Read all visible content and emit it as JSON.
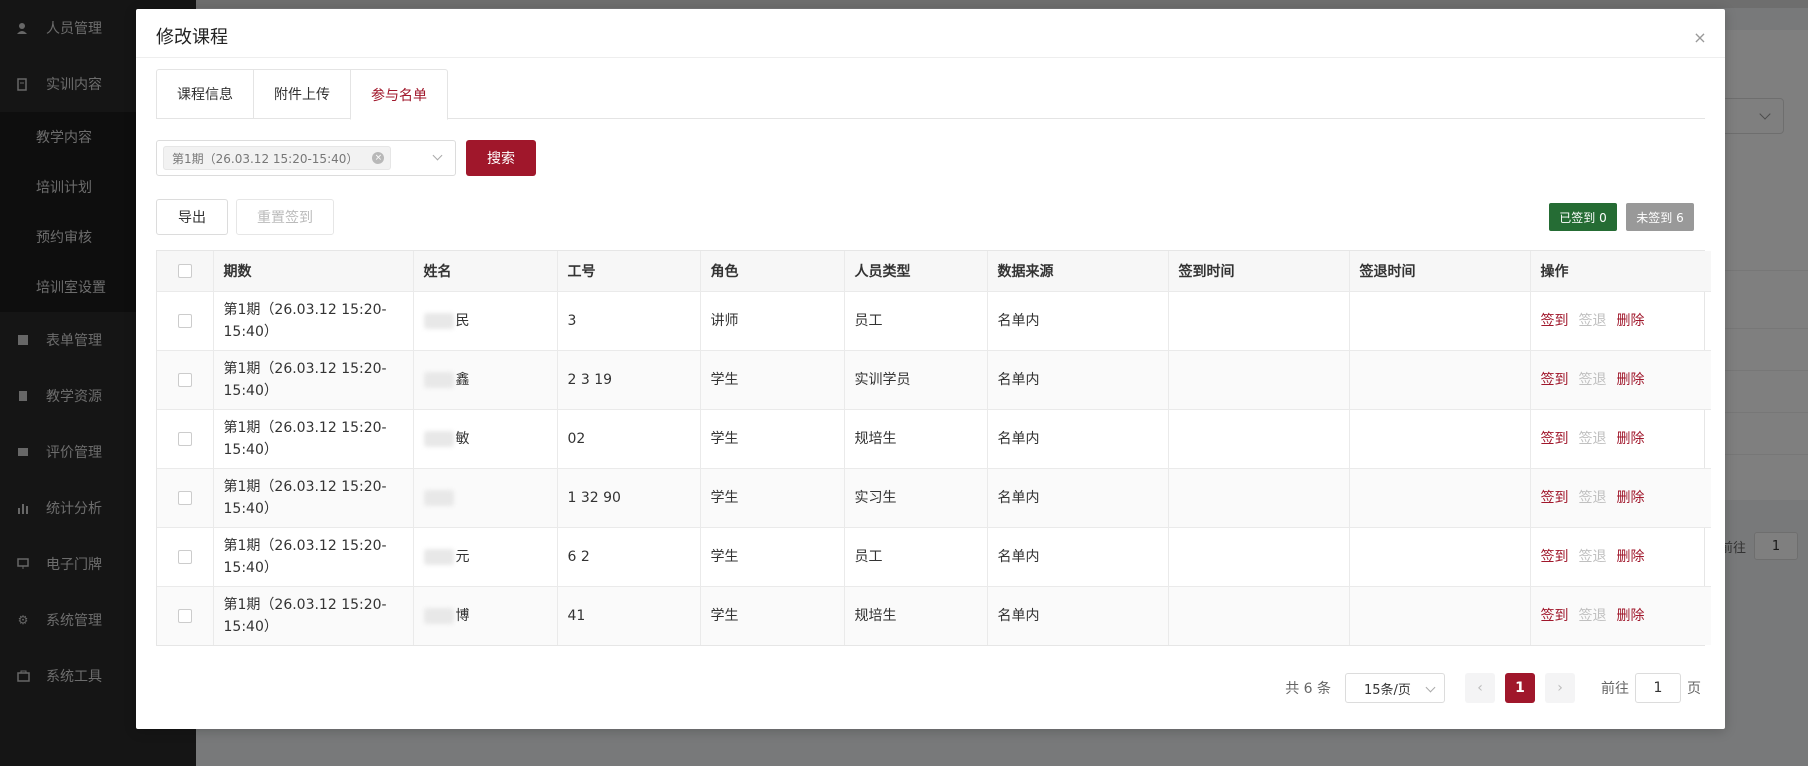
{
  "sidebar": {
    "items": [
      {
        "label": "人员管理",
        "icon": "user-icon"
      },
      {
        "label": "实训内容",
        "icon": "content-icon"
      }
    ],
    "subitems": [
      {
        "label": "教学内容"
      },
      {
        "label": "培训计划"
      },
      {
        "label": "预约审核"
      },
      {
        "label": "培训室设置"
      }
    ],
    "items2": [
      {
        "label": "表单管理",
        "icon": "form-icon"
      },
      {
        "label": "教学资源",
        "icon": "resource-icon"
      },
      {
        "label": "评价管理",
        "icon": "evaluate-icon"
      },
      {
        "label": "统计分析",
        "icon": "chart-icon"
      },
      {
        "label": "电子门牌",
        "icon": "monitor-icon"
      },
      {
        "label": "系统管理",
        "icon": "gear-icon"
      },
      {
        "label": "系统工具",
        "icon": "toolbox-icon"
      }
    ]
  },
  "background": {
    "goto_label": "前往",
    "goto_value": "1"
  },
  "modal": {
    "title": "修改课程",
    "close_icon": "×"
  },
  "tabs": [
    {
      "label": "课程信息"
    },
    {
      "label": "附件上传"
    },
    {
      "label": "参与名单"
    }
  ],
  "filter": {
    "tag": "第1期（26.03.12 15:20-15:40）",
    "search_label": "搜索"
  },
  "toolbar": {
    "export_label": "导出",
    "reset_label": "重置签到",
    "signed_in": "已签到 0",
    "not_signed": "未签到 6"
  },
  "table": {
    "headers": [
      "期数",
      "姓名",
      "工号",
      "角色",
      "人员类型",
      "数据来源",
      "签到时间",
      "签退时间",
      "操作"
    ],
    "rows": [
      {
        "period": "第1期（26.03.12 15:20-15:40）",
        "name": "民",
        "id": "3",
        "role": "讲师",
        "type": "员工",
        "source": "名单内"
      },
      {
        "period": "第1期（26.03.12 15:20-15:40）",
        "name": "鑫",
        "id": "2 3 19",
        "role": "学生",
        "type": "实训学员",
        "source": "名单内"
      },
      {
        "period": "第1期（26.03.12 15:20-15:40）",
        "name": "敏",
        "id": "02",
        "role": "学生",
        "type": "规培生",
        "source": "名单内"
      },
      {
        "period": "第1期（26.03.12 15:20-15:40）",
        "name": "",
        "id": "1 32 90",
        "role": "学生",
        "type": "实习生",
        "source": "名单内"
      },
      {
        "period": "第1期（26.03.12 15:20-15:40）",
        "name": "元",
        "id": "6 2",
        "role": "学生",
        "type": "员工",
        "source": "名单内"
      },
      {
        "period": "第1期（26.03.12 15:20-15:40）",
        "name": "博",
        "id": "41",
        "role": "学生",
        "type": "规培生",
        "source": "名单内"
      }
    ],
    "actions": {
      "sign_in": "签到",
      "sign_out": "签退",
      "delete": "删除"
    }
  },
  "pagination": {
    "total": "共 6 条",
    "page_size": "15条/页",
    "current": "1",
    "goto_label": "前往",
    "goto_value": "1",
    "page_suffix": "页"
  }
}
